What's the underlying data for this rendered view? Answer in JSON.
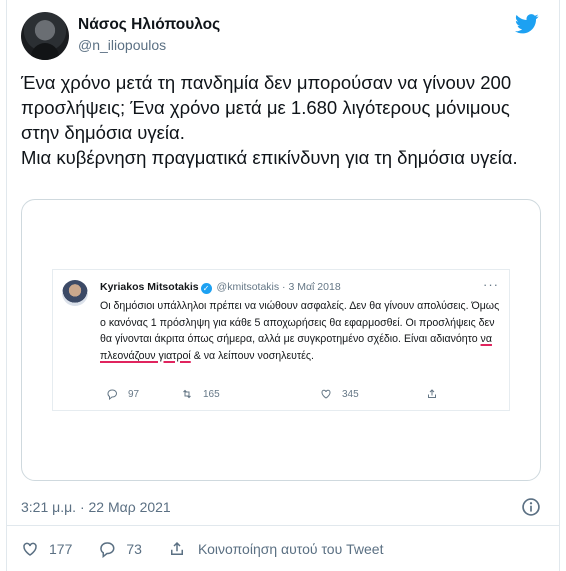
{
  "author": {
    "name": "Νάσος Ηλιόπουλος",
    "handle": "@n_iliopoulos"
  },
  "tweet": {
    "text": "Ένα χρόνο μετά τη πανδημία δεν μπορούσαν να γίνουν 200 προσλήψεις; Ένα χρόνο μετά με 1.680 λιγότερους μόνιμους στην δημόσια υγεία.\nΜια κυβέρνηση πραγματικά επικίνδυνη για τη δημόσια υγεία.",
    "timestamp": "3:21 μ.μ. · 22 Μαρ 2021"
  },
  "quoted": {
    "name": "Kyriakos Mitsotakis",
    "verified_mark": "✓",
    "handle": "@kmitsotakis",
    "separator": " · ",
    "date": "3 Μαΐ 2018",
    "text_before": "Οι δημόσιοι υπάλληλοι πρέπει να νιώθουν ασφαλείς. Δεν θα γίνουν απολύσεις. Όμως ο κανόνας 1 πρόσληψη για κάθε 5 αποχωρήσεις θα εφαρμοσθεί. Οι προσλήψεις δεν θα γίνονται άκριτα όπως σήμερα, αλλά με συγκροτημένο σχέδιο. Είναι αδιανόητο ",
    "text_underlined": "να πλεονάζουν γιατροί",
    "text_after": " & να λείπουν νοσηλευτές.",
    "more": "···",
    "replies": "97",
    "retweets": "165",
    "likes": "345"
  },
  "actions": {
    "likes": "177",
    "replies": "73",
    "share_label": "Κοινοποίηση αυτού του Tweet"
  },
  "colors": {
    "twitter_blue": "#1da1f2",
    "underline_red": "#e0245e",
    "muted_text": "#5b7083"
  }
}
